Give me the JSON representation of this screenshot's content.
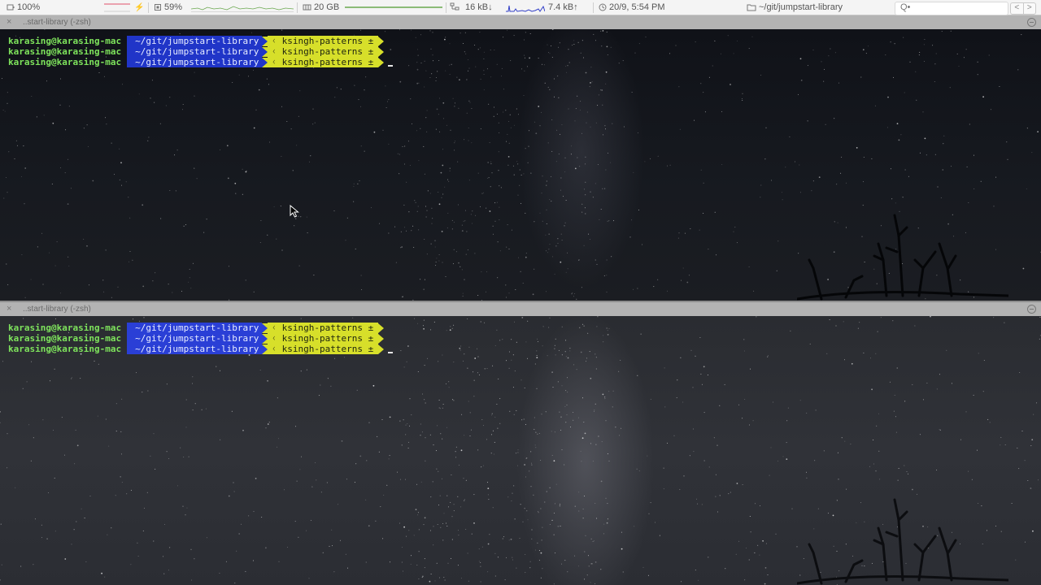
{
  "statusbar": {
    "battery": "100%",
    "cpu": "59%",
    "memory": "20 GB",
    "net_down": "16 kB↓",
    "net_up": "7.4 kB↑",
    "datetime": "20/9, 5:54 PM",
    "path": "~/git/jumpstart-library",
    "search_glyph": "Q•",
    "nav_back": "<",
    "nav_forward": ">"
  },
  "panes": [
    {
      "header_close": "×",
      "header_title": "..start-library (-zsh)",
      "lines": [
        {
          "user": "karasing@karasing-mac",
          "dir": "~/git/jumpstart-library",
          "git": "ᚲ ksingh-patterns ±"
        },
        {
          "user": "karasing@karasing-mac",
          "dir": "~/git/jumpstart-library",
          "git": "ᚲ ksingh-patterns ±"
        },
        {
          "user": "karasing@karasing-mac",
          "dir": "~/git/jumpstart-library",
          "git": "ᚲ ksingh-patterns ±"
        }
      ]
    },
    {
      "header_close": "×",
      "header_title": "..start-library (-zsh)",
      "lines": [
        {
          "user": "karasing@karasing-mac",
          "dir": "~/git/jumpstart-library",
          "git": "ᚲ ksingh-patterns ±"
        },
        {
          "user": "karasing@karasing-mac",
          "dir": "~/git/jumpstart-library",
          "git": "ᚲ ksingh-patterns ±"
        },
        {
          "user": "karasing@karasing-mac",
          "dir": "~/git/jumpstart-library",
          "git": "ᚲ ksingh-patterns ±"
        }
      ]
    }
  ],
  "icons": {
    "battery": "battery-icon",
    "cpu": "cpu-icon",
    "memory": "memory-icon",
    "network": "network-icon",
    "clock": "clock-icon",
    "folder": "folder-icon",
    "search": "search-icon",
    "close": "close-icon",
    "maximize": "maximize-icon",
    "cursor": "mouse-pointer-icon"
  },
  "colors": {
    "prompt_user": "#7ee35c",
    "prompt_dir_bg": "#2a3fd6",
    "prompt_git_bg": "#d7df2a"
  }
}
